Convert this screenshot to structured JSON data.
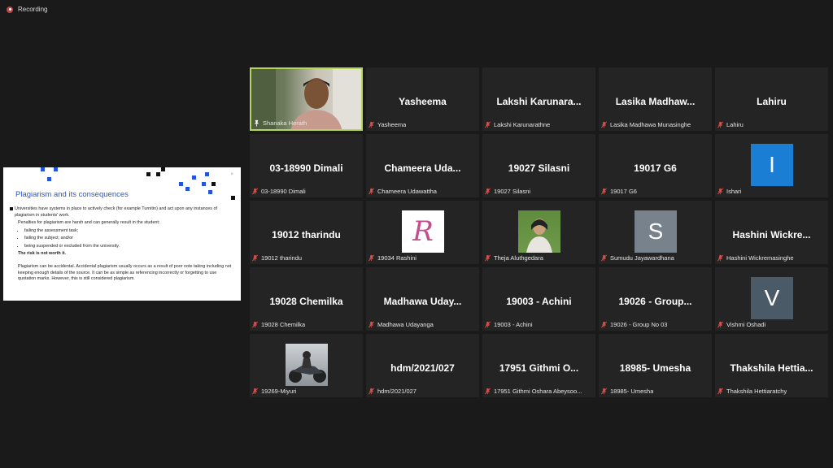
{
  "recording": {
    "label": "Recording"
  },
  "slide": {
    "title": "Plagiarism and its consequences",
    "close": "×",
    "lead": "Universities have systems in place to actively check (for example Turnitin) and act upon any instances of plagiarism in students' work.",
    "penalties_intro": "Penalties for plagiarism are harsh and can generally result in the student:",
    "bullets": [
      "failing the assessment task;",
      "failing the subject; and/or",
      "being suspended or excluded from the university."
    ],
    "risk": "The risk is not worth it.",
    "accidental": "Plagiarism can be accidental. Accidental plagiarism usually occurs as a result of poor note taking including not keeping enough details of the source. It can be as simple as referencing incorrectly or forgetting to use quotation marks. However, this is still considered plagiarism."
  },
  "participants": [
    {
      "label": "Shanaka Herath",
      "type": "video",
      "active": true
    },
    {
      "big": "Yasheema",
      "label": "Yasheema"
    },
    {
      "big": "Lakshi Karunara...",
      "label": "Lakshi Karunarathne"
    },
    {
      "big": "Lasika Madhaw...",
      "label": "Lasika Madhawa Munasinghe"
    },
    {
      "big": "Lahiru",
      "label": "Lahiru"
    },
    {
      "big": "03-18990 Dimali",
      "label": "03-18990 Dimali"
    },
    {
      "big": "Chameera Uda...",
      "label": "Chameera Udawattha"
    },
    {
      "big": "19027 Silasni",
      "label": "19027 Silasni"
    },
    {
      "big": "19017 G6",
      "label": "19017  G6"
    },
    {
      "avatar": "I",
      "avatar_color": "#1a7ed4",
      "label": "Ishari"
    },
    {
      "big": "19012 tharindu",
      "label": "19012 tharindu"
    },
    {
      "avatar": "R",
      "avatar_style": "r",
      "label": "19034 Rashini"
    },
    {
      "avatar_style": "lady",
      "label": "Theja Aluthgedara"
    },
    {
      "avatar": "S",
      "avatar_color": "#77828c",
      "label": "Sumudu Jayawardhana"
    },
    {
      "big": "Hashini Wickre...",
      "label": "Hashini Wickremasinghe"
    },
    {
      "big": "19028 Chemilka",
      "label": "19028 Chemilka"
    },
    {
      "big": "Madhawa Uday...",
      "label": "Madhawa Udayanga"
    },
    {
      "big": "19003 - Achini",
      "label": "19003 - Achini"
    },
    {
      "big": "19026 - Group...",
      "label": "19026 - Group No 03"
    },
    {
      "avatar": "V",
      "avatar_color": "#4a5a66",
      "label": "Vishmi Oshadi"
    },
    {
      "avatar_style": "bike",
      "label": "19269-Miyuri"
    },
    {
      "big": "hdm/2021/027",
      "label": "hdm/2021/027"
    },
    {
      "big": "17951 Githmi O...",
      "label": "17951 Githmi Oshara Abeysoo..."
    },
    {
      "big": "18985- Umesha",
      "label": "18985- Umesha"
    },
    {
      "big": "Thakshila Hettia...",
      "label": "Thakshila Hettiaratchy"
    }
  ],
  "colors": {
    "active_border": "#b4d75a",
    "muted_mic": "#d9534f",
    "tile_bg": "#242424"
  }
}
